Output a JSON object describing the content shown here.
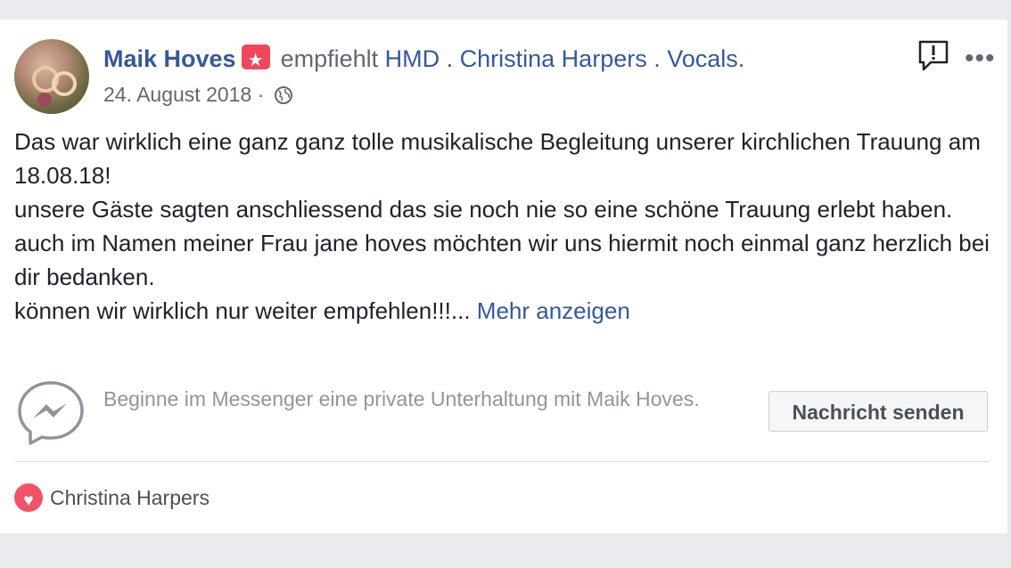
{
  "post": {
    "author": "Maik Hoves",
    "recommends": "empfiehlt",
    "page": "HMD . Christina Harpers . Vocals.",
    "date": "24. August 2018",
    "separator": "·",
    "text_lines": [
      "Das war wirklich eine ganz ganz tolle musikalische Begleitung unserer kirchlichen Trauung am 18.08.18!",
      "unsere Gäste sagten anschliessend das sie noch nie so eine schöne Trauung erlebt haben.",
      "auch im Namen meiner Frau jane hoves möchten wir uns hiermit noch einmal ganz herzlich bei dir bedanken."
    ],
    "last_line": "können wir wirklich nur weiter empfehlen!!!...",
    "more_link": "Mehr anzeigen",
    "more_menu": "•••"
  },
  "messenger": {
    "prompt": "Beginne im Messenger eine private Unterhaltung mit Maik Hoves.",
    "button_label": "Nachricht senden"
  },
  "reactions": {
    "name": "Christina Harpers"
  },
  "icons": {
    "badge": "star-recommendation-icon",
    "privacy": "globe-icon",
    "report": "report-icon",
    "more": "more-options-icon",
    "messenger": "messenger-icon",
    "reaction": "heart-icon"
  },
  "colors": {
    "link": "#365899",
    "badge": "#f0465c",
    "heart": "#f25268"
  }
}
